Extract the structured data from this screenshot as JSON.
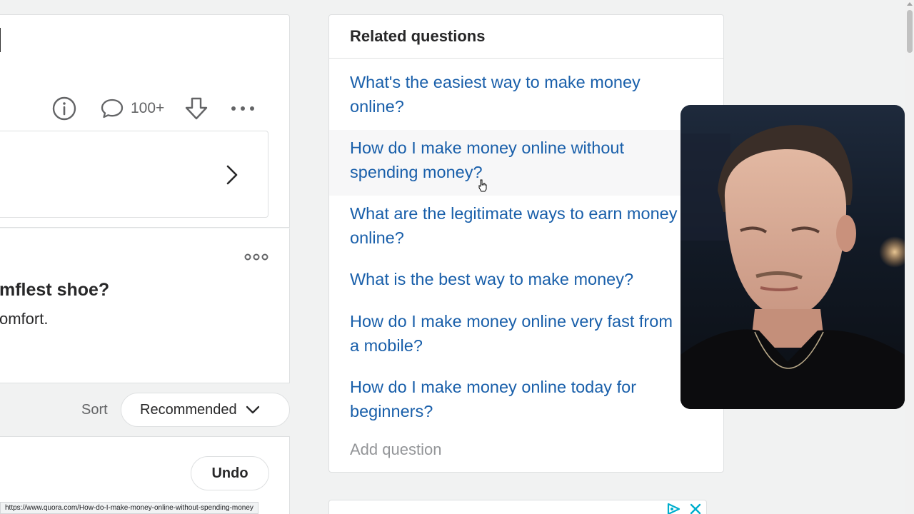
{
  "question_card": {
    "comment_count": "100+"
  },
  "answer_card": {
    "title_fragment": "mflest shoe?",
    "body_fragment": "omfort."
  },
  "sort": {
    "label": "Sort",
    "selected": "Recommended"
  },
  "undo": {
    "label": "Undo"
  },
  "related": {
    "heading": "Related questions",
    "items": [
      "What's the easiest way to make money online?",
      "How do I make money online without spending money?",
      "What are the legitimate ways to earn money online?",
      "What is the best way to make money?",
      "How do I make money online very fast from a mobile?",
      "How do I make money online today for beginners?"
    ],
    "add_question": "Add question"
  },
  "status_bar": {
    "url": "https://www.quora.com/How-do-I-make-money-online-without-spending-money"
  },
  "icons": {
    "info": "info-icon",
    "comment": "comment-icon",
    "downvote": "downvote-icon",
    "more": "more-icon",
    "chevron_right": "chevron-right-icon",
    "chevron_down": "chevron-down-icon",
    "ad_choices": "ad-choices-icon",
    "close": "close-icon"
  },
  "colors": {
    "link": "#195faa",
    "text": "#282829",
    "muted": "#636466",
    "placeholder": "#939598",
    "background": "#f1f2f2",
    "ad_blue": "#00aecd"
  }
}
